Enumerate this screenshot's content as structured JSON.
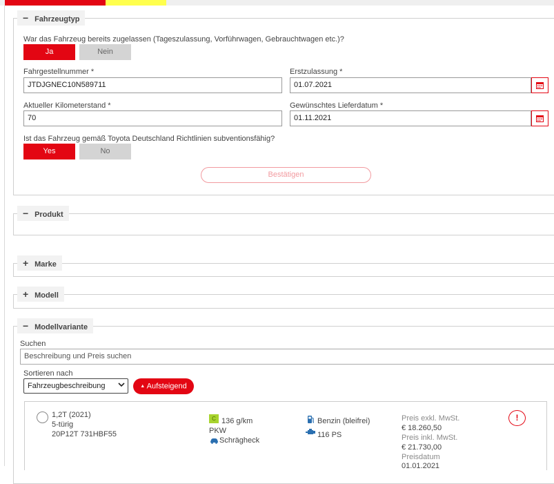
{
  "sections": {
    "fahrzeugtyp": {
      "title": "Fahrzeugtyp",
      "question_registered": "War das Fahrzeug bereits zugelassen (Tageszulassung, Vorführwagen, Gebrauchtwagen etc.)?",
      "yes_label": "Ja",
      "no_label": "Nein",
      "vin_label": "Fahrgestellnummer *",
      "vin_value": "JTDJGNEC10N589711",
      "first_reg_label": "Erstzulassung *",
      "first_reg_value": "01.07.2021",
      "mileage_label": "Aktueller Kilometerstand *",
      "mileage_value": "70",
      "delivery_label": "Gewünschtes Lieferdatum *",
      "delivery_value": "01.11.2021",
      "question_subsidy": "Ist das Fahrzeug gemäß Toyota Deutschland Richtlinien subventionsfähig?",
      "subsidy_yes_label": "Yes",
      "subsidy_no_label": "No",
      "confirm_label": "Bestätigen"
    },
    "produkt": {
      "title": "Produkt"
    },
    "marke": {
      "title": "Marke"
    },
    "modell": {
      "title": "Modell"
    },
    "modellvariante": {
      "title": "Modellvariante",
      "search_label": "Suchen",
      "search_placeholder": "Beschreibung und Preis suchen",
      "sort_label": "Sortieren nach",
      "sort_selected": "Fahrzeugbeschreibung",
      "sort_dir_label": "Aufsteigend"
    }
  },
  "variant": {
    "name": "1,2T (2021)",
    "doors": "5-türig",
    "code": "20P12T 731HBF55",
    "eco_class": "C",
    "co2": "136 g/km",
    "vehicle_type": "PKW",
    "body": "Schrägheck",
    "fuel": "Benzin (bleifrei)",
    "power": "116 PS",
    "price_excl_label": "Preis exkl. MwSt.",
    "price_excl": "€ 18.260,50",
    "price_incl_label": "Preis inkl. MwSt.",
    "price_incl": "€ 21.730,00",
    "price_date_label": "Preisdatum",
    "price_date": "01.01.2021"
  },
  "icons": {
    "collapse": "minus-icon",
    "expand": "plus-icon",
    "calendar": "calendar-icon",
    "car": "car-icon",
    "fuel": "fuel-pump-icon",
    "engine": "engine-icon",
    "info": "info-icon"
  },
  "colors": {
    "accent": "#e30613",
    "tab_highlight": "#ffff4d"
  }
}
